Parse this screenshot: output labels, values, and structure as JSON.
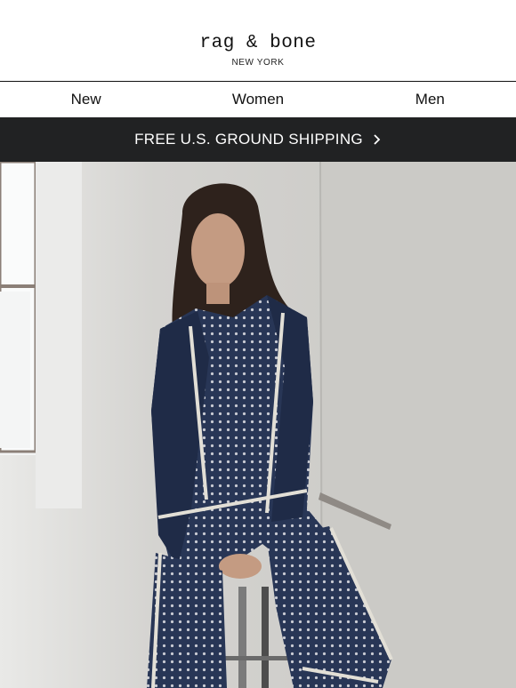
{
  "brand": {
    "logo_text": "rag & bone",
    "sub_text": "NEW YORK"
  },
  "nav": {
    "items": [
      {
        "label": "New"
      },
      {
        "label": "Women"
      },
      {
        "label": "Men"
      }
    ]
  },
  "banner": {
    "text": "FREE U.S. GROUND SHIPPING",
    "icon": "chevron-right-icon"
  },
  "hero": {
    "description_icon": "model-photo"
  },
  "colors": {
    "banner_bg": "#212223",
    "banner_text": "#ffffff",
    "pajama_navy": "#1f2b47",
    "wall": "#cfcecb"
  }
}
